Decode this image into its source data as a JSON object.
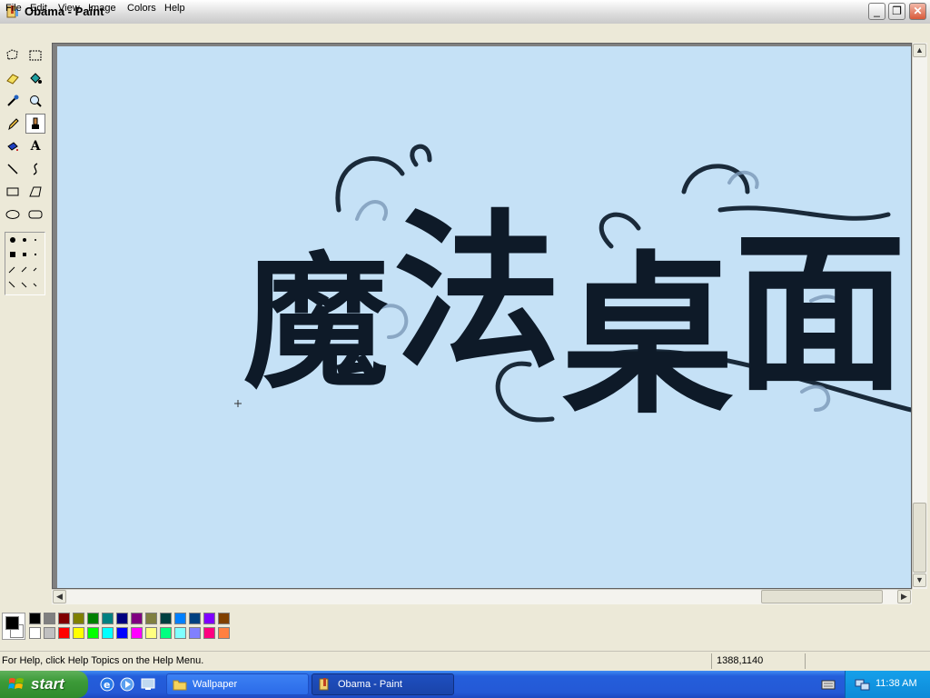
{
  "window": {
    "title": "Obama - Paint",
    "minimize_label": "_",
    "restore_label": "❐",
    "close_label": "✕"
  },
  "menu": [
    "File",
    "Edit",
    "View",
    "Image",
    "Colors",
    "Help"
  ],
  "tools": [
    "free-form-select",
    "rect-select",
    "eraser",
    "fill-with-color",
    "pick-color",
    "magnifier",
    "pencil",
    "brush",
    "airbrush",
    "text",
    "line",
    "curve",
    "rectangle",
    "polygon",
    "ellipse",
    "rounded-rectangle"
  ],
  "active_tool": "brush",
  "canvas": {
    "background": "#c5e1f6",
    "artwork_text": [
      "魔",
      "法",
      "桌",
      "面"
    ]
  },
  "palette": {
    "foreground": "#000000",
    "background": "#ffffff",
    "colors_top": [
      "#000000",
      "#808080",
      "#800000",
      "#808000",
      "#008000",
      "#008080",
      "#000080",
      "#800080",
      "#808040",
      "#004040",
      "#0080ff",
      "#004080",
      "#8000ff",
      "#804000"
    ],
    "colors_bottom": [
      "#ffffff",
      "#c0c0c0",
      "#ff0000",
      "#ffff00",
      "#00ff00",
      "#00ffff",
      "#0000ff",
      "#ff00ff",
      "#ffff80",
      "#00ff80",
      "#80ffff",
      "#8080ff",
      "#ff0080",
      "#ff8040"
    ]
  },
  "status": {
    "help_text": "For Help, click Help Topics on the Help Menu.",
    "coordinates": "1388,1140"
  },
  "taskbar": {
    "start_label": "start",
    "buttons": [
      {
        "label": "Wallpaper",
        "active": false
      },
      {
        "label": "Obama - Paint",
        "active": true
      }
    ],
    "clock": "11:38 AM"
  }
}
